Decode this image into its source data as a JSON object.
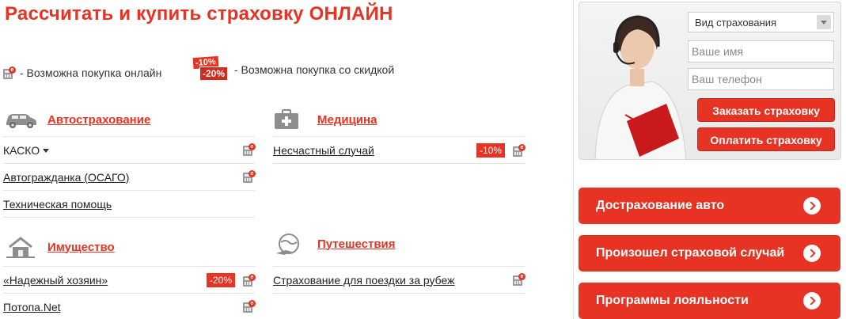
{
  "title": "Рассчитать и купить страховку ОНЛАЙН",
  "legend": {
    "online_text": "- Возможна покупка онлайн",
    "discount_text": "- Возможна покупка со скидкой",
    "discount_badges": [
      "-10%",
      "-20%"
    ]
  },
  "categories": {
    "auto": {
      "label": "Автострахование",
      "items": [
        {
          "label": "КАСКО",
          "online": true
        },
        {
          "label": "Автогражданка (ОСАГО)",
          "online": true
        },
        {
          "label": "Техническая помощь",
          "online": false
        }
      ]
    },
    "medicine": {
      "label": "Медицина",
      "items": [
        {
          "label": "Несчастный случай",
          "badge": "-10%",
          "online": true
        }
      ]
    },
    "property": {
      "label": "Имущество",
      "items": [
        {
          "label": "«Надежный хозяин»",
          "badge": "-20%",
          "online": true
        },
        {
          "label": "Потопа.Net",
          "online": true
        }
      ]
    },
    "travel": {
      "label": "Путешествия",
      "items": [
        {
          "label": "Страхование для поездки за рубеж",
          "online": true
        }
      ]
    }
  },
  "order_form": {
    "select_value": "Вид страхования",
    "name_placeholder": "Ваше имя",
    "phone_placeholder": "Ваш телефон",
    "order_button": "Заказать страховку",
    "pay_button": "Оплатить страховку"
  },
  "actions": [
    {
      "label": "Дострахование авто"
    },
    {
      "label": "Произошел страховой случай"
    },
    {
      "label": "Программы лояльности"
    }
  ],
  "colors": {
    "accent": "#e63323",
    "text": "#222222",
    "divider": "#e4e4e4"
  }
}
